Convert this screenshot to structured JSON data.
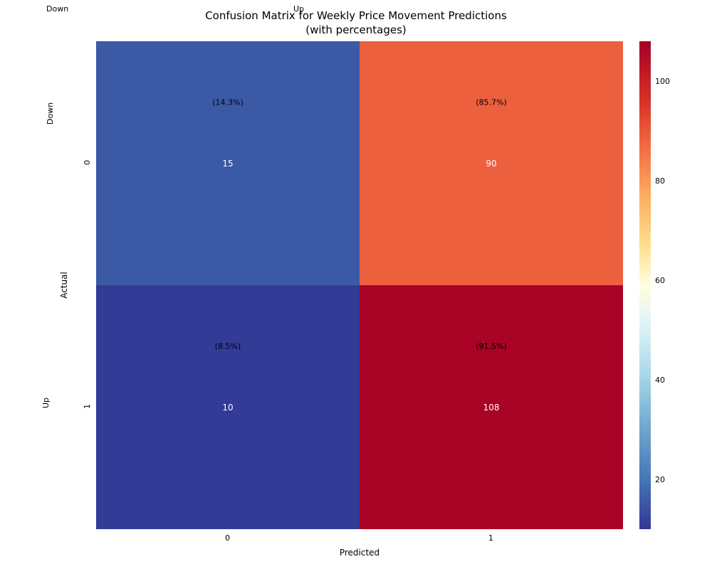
{
  "chart_data": {
    "type": "heatmap",
    "title": "Confusion Matrix for Weekly Price Movement Predictions\n(with percentages)",
    "xlabel": "Predicted",
    "ylabel": "Actual",
    "x_inner_ticks": [
      "0",
      "1"
    ],
    "y_inner_ticks": [
      "0",
      "1"
    ],
    "x_outer_labels": [
      "Down",
      "Up"
    ],
    "y_outer_labels": [
      "Down",
      "Up"
    ],
    "cells": [
      {
        "row": 0,
        "col": 0,
        "count": 15,
        "pct": "(14.3%)",
        "color": "#3c59a6"
      },
      {
        "row": 0,
        "col": 1,
        "count": 90,
        "pct": "(85.7%)",
        "color": "#ec603e"
      },
      {
        "row": 1,
        "col": 0,
        "count": 10,
        "pct": "(8.5%)",
        "color": "#323b96"
      },
      {
        "row": 1,
        "col": 1,
        "count": 108,
        "pct": "(91.5%)",
        "color": "#a90326"
      }
    ],
    "colorbar_ticks": [
      "20",
      "40",
      "60",
      "80",
      "100"
    ],
    "colorbar_range": [
      10,
      108
    ]
  }
}
